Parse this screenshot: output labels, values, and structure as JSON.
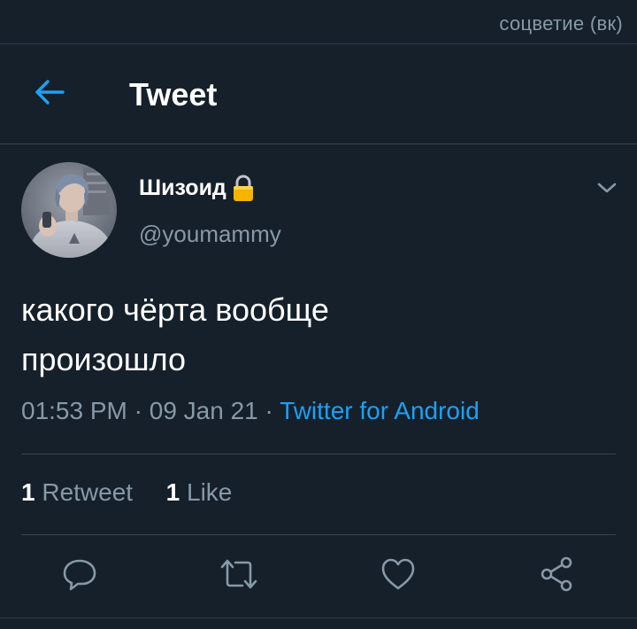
{
  "watermark": "соцветие (вк)",
  "header": {
    "title": "Tweet",
    "back_icon": "arrow-left-icon"
  },
  "tweet": {
    "author": {
      "display_name": "Шизоид",
      "handle": "@youmammy",
      "protected": true,
      "lock_icon": "lock-icon"
    },
    "text_lines": [
      "какого чёрта вообще",
      "произошло"
    ],
    "time": "01:53 PM",
    "date": "09 Jan 21",
    "separator": "·",
    "source": "Twitter for Android",
    "retweets_count": "1",
    "retweets_label": "Retweet",
    "likes_count": "1",
    "likes_label": "Like"
  },
  "actions": [
    {
      "name": "reply",
      "icon": "reply-icon"
    },
    {
      "name": "retweet",
      "icon": "retweet-icon"
    },
    {
      "name": "like",
      "icon": "heart-icon"
    },
    {
      "name": "share",
      "icon": "share-icon"
    }
  ],
  "colors": {
    "background": "#15202b",
    "accent": "#1da1f2",
    "secondary_text": "#8899a6",
    "divider": "#38444d"
  }
}
